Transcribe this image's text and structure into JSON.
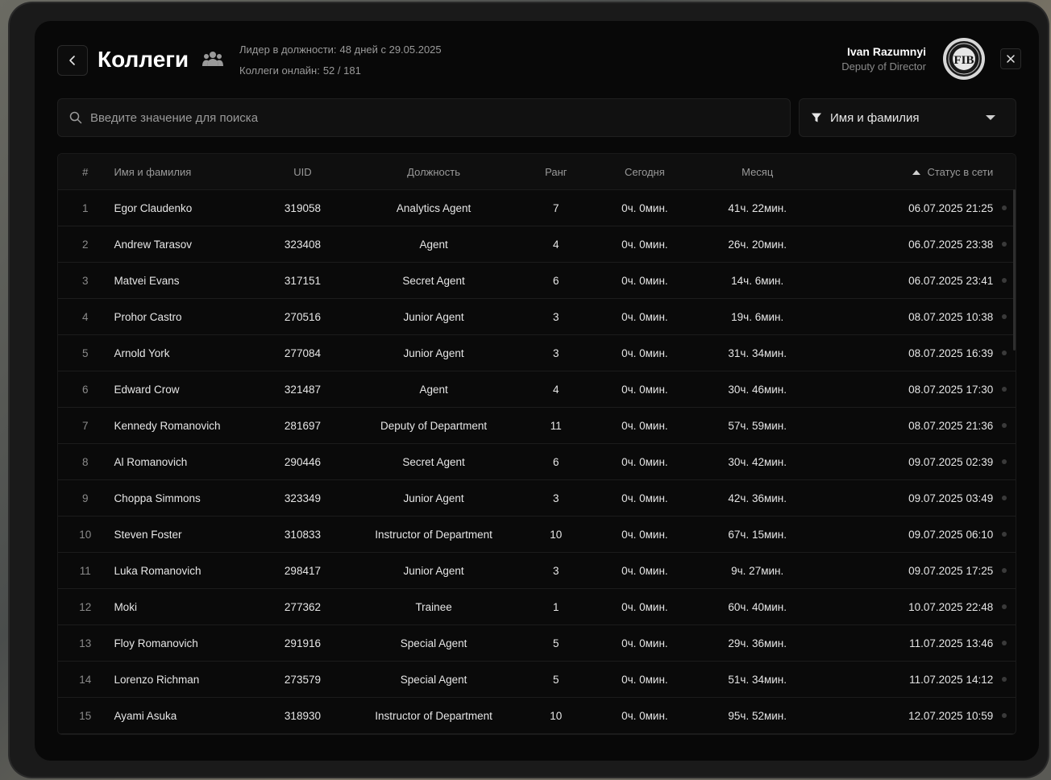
{
  "header": {
    "title": "Коллеги",
    "leader_label": "Лидер в должности:",
    "leader_value": "48 дней  с 29.05.2025",
    "online_label": "Коллеги онлайн:",
    "online_value": "52 / 181"
  },
  "user": {
    "name": "Ivan Razumnyi",
    "role": "Deputy of Director",
    "emblem_text": "FIB"
  },
  "search": {
    "placeholder": "Введите значение для поиска"
  },
  "filter": {
    "selected": "Имя и фамилия"
  },
  "table": {
    "columns": {
      "num": "#",
      "name": "Имя и фамилия",
      "uid": "UID",
      "position": "Должность",
      "rank": "Ранг",
      "today": "Сегодня",
      "month": "Месяц",
      "status": "Статус в сети"
    },
    "rows": [
      {
        "num": "1",
        "name": "Egor Claudenko",
        "uid": "319058",
        "position": "Analytics Agent",
        "rank": "7",
        "today": "0ч. 0мин.",
        "month": "41ч. 22мин.",
        "status": "06.07.2025 21:25"
      },
      {
        "num": "2",
        "name": "Andrew Tarasov",
        "uid": "323408",
        "position": "Agent",
        "rank": "4",
        "today": "0ч. 0мин.",
        "month": "26ч. 20мин.",
        "status": "06.07.2025 23:38"
      },
      {
        "num": "3",
        "name": "Matvei Evans",
        "uid": "317151",
        "position": "Secret Agent",
        "rank": "6",
        "today": "0ч. 0мин.",
        "month": "14ч. 6мин.",
        "status": "06.07.2025 23:41"
      },
      {
        "num": "4",
        "name": "Prohor Castro",
        "uid": "270516",
        "position": "Junior Agent",
        "rank": "3",
        "today": "0ч. 0мин.",
        "month": "19ч. 6мин.",
        "status": "08.07.2025 10:38"
      },
      {
        "num": "5",
        "name": "Arnold York",
        "uid": "277084",
        "position": "Junior Agent",
        "rank": "3",
        "today": "0ч. 0мин.",
        "month": "31ч. 34мин.",
        "status": "08.07.2025 16:39"
      },
      {
        "num": "6",
        "name": "Edward Crow",
        "uid": "321487",
        "position": "Agent",
        "rank": "4",
        "today": "0ч. 0мин.",
        "month": "30ч. 46мин.",
        "status": "08.07.2025 17:30"
      },
      {
        "num": "7",
        "name": "Kennedy Romanovich",
        "uid": "281697",
        "position": "Deputy of Department",
        "rank": "11",
        "today": "0ч. 0мин.",
        "month": "57ч. 59мин.",
        "status": "08.07.2025 21:36"
      },
      {
        "num": "8",
        "name": "Al Romanovich",
        "uid": "290446",
        "position": "Secret Agent",
        "rank": "6",
        "today": "0ч. 0мин.",
        "month": "30ч. 42мин.",
        "status": "09.07.2025 02:39"
      },
      {
        "num": "9",
        "name": "Choppa Simmons",
        "uid": "323349",
        "position": "Junior Agent",
        "rank": "3",
        "today": "0ч. 0мин.",
        "month": "42ч. 36мин.",
        "status": "09.07.2025 03:49"
      },
      {
        "num": "10",
        "name": "Steven Foster",
        "uid": "310833",
        "position": "Instructor of Department",
        "rank": "10",
        "today": "0ч. 0мин.",
        "month": "67ч. 15мин.",
        "status": "09.07.2025 06:10"
      },
      {
        "num": "11",
        "name": "Luka Romanovich",
        "uid": "298417",
        "position": "Junior Agent",
        "rank": "3",
        "today": "0ч. 0мин.",
        "month": "9ч. 27мин.",
        "status": "09.07.2025 17:25"
      },
      {
        "num": "12",
        "name": "Moki",
        "uid": "277362",
        "position": "Trainee",
        "rank": "1",
        "today": "0ч. 0мин.",
        "month": "60ч. 40мин.",
        "status": "10.07.2025 22:48"
      },
      {
        "num": "13",
        "name": "Floy Romanovich",
        "uid": "291916",
        "position": "Special Agent",
        "rank": "5",
        "today": "0ч. 0мин.",
        "month": "29ч. 36мин.",
        "status": "11.07.2025 13:46"
      },
      {
        "num": "14",
        "name": "Lorenzo Richman",
        "uid": "273579",
        "position": "Special Agent",
        "rank": "5",
        "today": "0ч. 0мин.",
        "month": "51ч. 34мин.",
        "status": "11.07.2025 14:12"
      },
      {
        "num": "15",
        "name": "Ayami Asuka",
        "uid": "318930",
        "position": "Instructor of Department",
        "rank": "10",
        "today": "0ч. 0мин.",
        "month": "95ч. 52мин.",
        "status": "12.07.2025 10:59"
      }
    ]
  },
  "colors": {
    "panel_bg": "#080808",
    "text": "#ffffff",
    "muted": "#9a9a9a",
    "offline_dot": "#3a3a3a"
  }
}
